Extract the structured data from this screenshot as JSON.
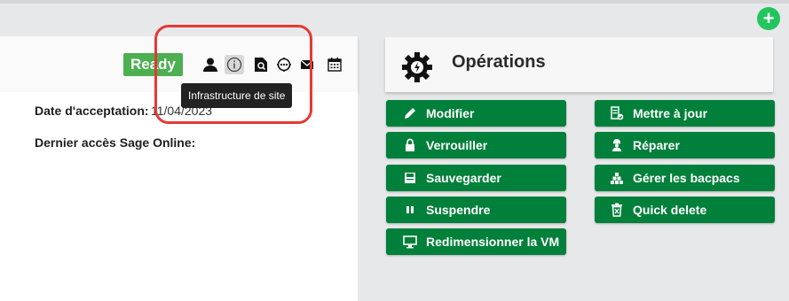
{
  "header": {
    "status": "Ready",
    "tooltip": "Infrastructure de site",
    "icons": [
      "user-icon",
      "info-icon",
      "search-document-icon",
      "network-icon",
      "mail-icon",
      "calendar-icon"
    ]
  },
  "details": {
    "acceptance_label": "Date d'acceptation:",
    "acceptance_value": "11/04/2023",
    "last_access_label": "Dernier accès Sage Online:"
  },
  "operations": {
    "title": "Opérations",
    "buttons_col1": [
      {
        "label": "Modifier",
        "icon": "pencil-icon"
      },
      {
        "label": "Verrouiller",
        "icon": "lock-icon"
      },
      {
        "label": "Sauvegarder",
        "icon": "save-icon"
      },
      {
        "label": "Suspendre",
        "icon": "pause-icon"
      },
      {
        "label": "Redimensionner la VM",
        "icon": "monitor-icon"
      }
    ],
    "buttons_col2": [
      {
        "label": "Mettre à jour",
        "icon": "update-icon"
      },
      {
        "label": "Réparer",
        "icon": "repair-icon"
      },
      {
        "label": "Gérer les bacpacs",
        "icon": "boxes-icon"
      },
      {
        "label": "Quick delete",
        "icon": "trash-icon"
      }
    ]
  },
  "colors": {
    "primary_button": "#00803a",
    "ready": "#4caf50",
    "fab": "#22c55e",
    "highlight": "#e53935"
  }
}
